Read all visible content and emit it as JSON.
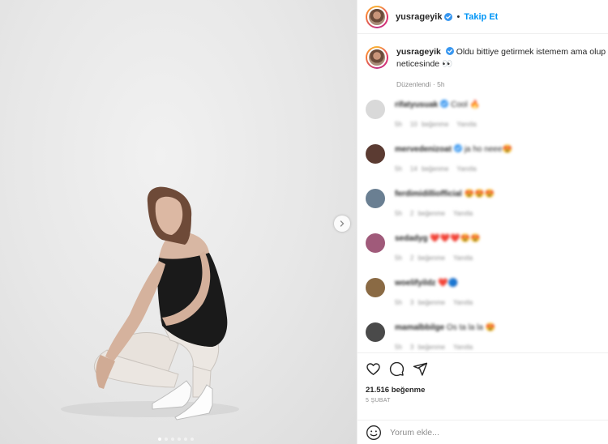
{
  "post": {
    "username": "yusrageyik",
    "follow_label": "Takip Et",
    "separator": "•",
    "caption_text": "Oldu bittiye getirmek istemem ama olup bi",
    "caption_line2": "neticesinde",
    "caption_emoji": "👀",
    "edited_label": "Düzenlendi",
    "edited_time": "5h",
    "meta_dot": "·",
    "media_dots": 6
  },
  "comments": [
    {
      "user": "rifatyusuak",
      "verified": true,
      "text": "Cool 🔥",
      "time": "5h",
      "likes": "10 beğenme",
      "reply": "Yanıtla",
      "avatar_color": "#d9d9d9"
    },
    {
      "user": "mervedenizoat",
      "verified": true,
      "text": "ja ho neee😍",
      "time": "5h",
      "likes": "14 beğenme",
      "reply": "Yanıtla",
      "avatar_color": "#5b3b32"
    },
    {
      "user": "ferdimidilliofficial",
      "verified": false,
      "text": "😍😍😍",
      "time": "5h",
      "likes": "2 beğenme",
      "reply": "Yanıtla",
      "avatar_color": "#6a7f92"
    },
    {
      "user": "sedadyg",
      "verified": false,
      "text": "❤️❤️❤️😍😍",
      "time": "5h",
      "likes": "2 beğenme",
      "reply": "Yanıtla",
      "avatar_color": "#a05a7a"
    },
    {
      "user": "woelifyildz",
      "verified": false,
      "text": "❤️🔵",
      "time": "5h",
      "likes": "3 beğenme",
      "reply": "Yanıtla",
      "avatar_color": "#8a6a44"
    },
    {
      "user": "mamalbbilge",
      "verified": false,
      "text": "Os ta la la 😍",
      "time": "5h",
      "likes": "3 beğenme",
      "reply": "Yanıtla",
      "avatar_color": "#4a4a4a"
    }
  ],
  "actions": {
    "likes": "21.516 beğenme",
    "date": "5 ŞUBAT"
  },
  "add_comment": {
    "placeholder": "Yorum ekle..."
  },
  "colors": {
    "accent": "#0095f6",
    "verified": "#3897f0",
    "muted": "#8e8e8e"
  },
  "icons": [
    "chevron-right-icon",
    "verified-badge-icon",
    "heart-icon",
    "comment-icon",
    "share-icon",
    "emoji-icon"
  ]
}
